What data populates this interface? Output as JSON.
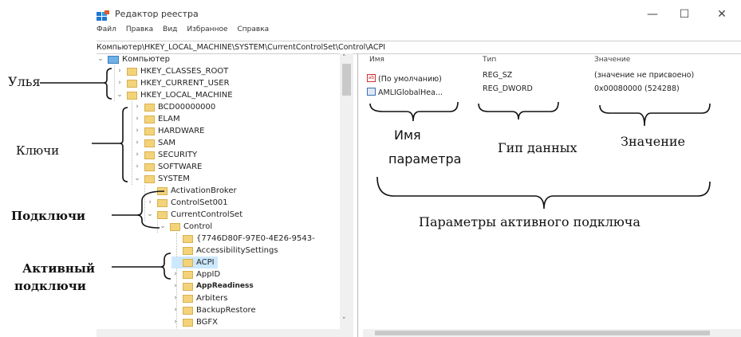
{
  "window": {
    "title": "Редактор реестра",
    "controls": {
      "minimize": "—",
      "maximize": "☐",
      "close": "✕"
    }
  },
  "menu": [
    "Файл",
    "Правка",
    "Вид",
    "Избранное",
    "Справка"
  ],
  "address": "Компьютер\\HKEY_LOCAL_MACHINE\\SYSTEM\\CurrentControlSet\\Control\\ACPI",
  "tree": {
    "root": "Компьютер",
    "hives": [
      "HKEY_CLASSES_ROOT",
      "HKEY_CURRENT_USER",
      "HKEY_LOCAL_MACHINE"
    ],
    "hklm_keys": [
      "BCD00000000",
      "ELAM",
      "HARDWARE",
      "SAM",
      "SECURITY",
      "SOFTWARE",
      "SYSTEM"
    ],
    "system_subkeys": [
      "ActivationBroker",
      "ControlSet001",
      "CurrentControlSet"
    ],
    "ccs_subkeys": [
      "Control"
    ],
    "control_subkeys": [
      "{7746D80F-97E0-4E26-9543-",
      "AccessibilitySettings",
      "ACPI",
      "AppID",
      "AppReadiness",
      "Arbiters",
      "BackupRestore",
      "BGFX"
    ]
  },
  "list": {
    "columns": {
      "name": "Имя",
      "type": "Тип",
      "data": "Значение"
    },
    "rows": [
      {
        "name": "(По умолчанию)",
        "type": "REG_SZ",
        "data": "(значение не присвоено)",
        "icon": "string-value-icon"
      },
      {
        "name": "AMLIGlobalHea...",
        "type": "REG_DWORD",
        "data": "0x00080000 (524288)",
        "icon": "dword-value-icon"
      }
    ]
  },
  "annotations": {
    "hives": "Улья",
    "keys": "Ключи",
    "subkeys": "Подключи",
    "active_subkey_line1": "Активный",
    "active_subkey_line2": "подключи",
    "param_name_line1": "Имя",
    "param_name_line2": "параметра",
    "data_type": "Гип данных",
    "value": "Значение",
    "active_params": "Параметры активного подключа"
  },
  "colors": {
    "selection": "#cce8ff",
    "folder": "#f3d37a",
    "accent": "#1e78d2"
  }
}
